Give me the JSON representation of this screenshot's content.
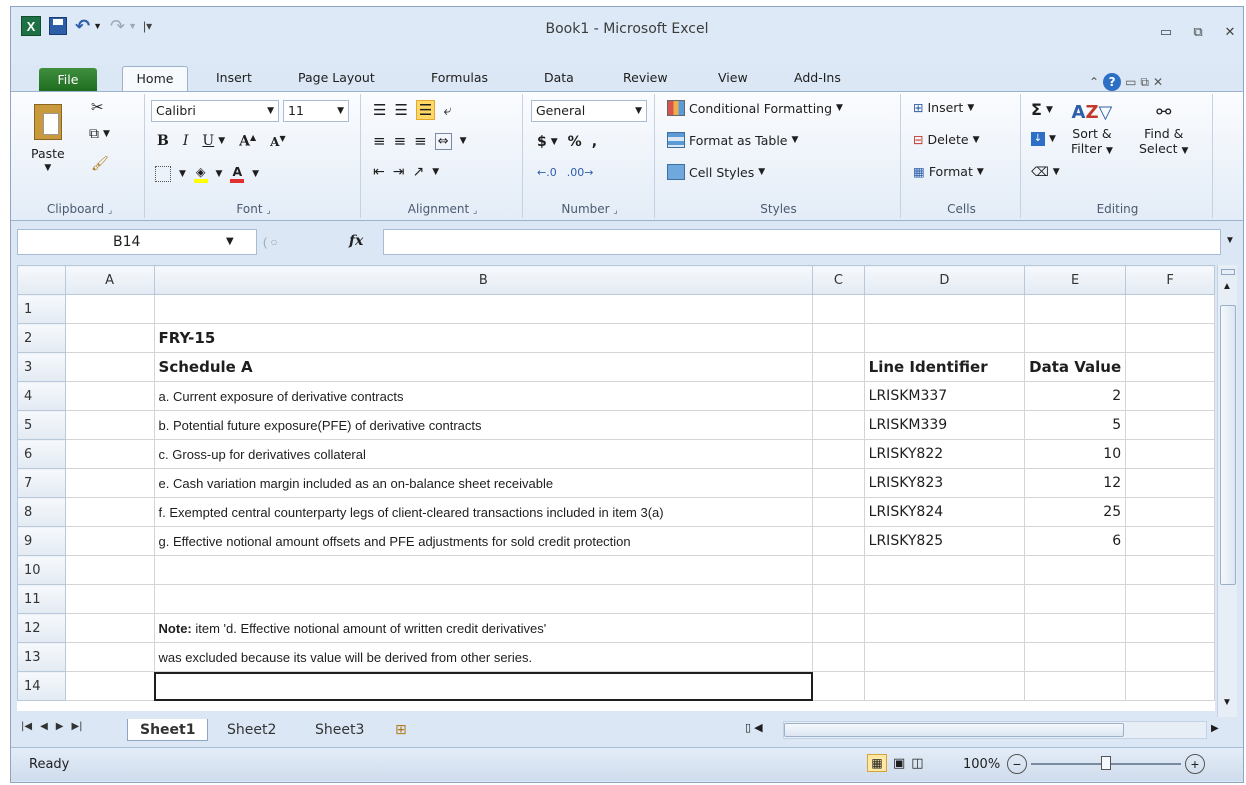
{
  "window": {
    "title": "Book1  -  Microsoft Excel",
    "minimize_glyph": "▭",
    "restore_glyph": "⧉",
    "close_glyph": "✕"
  },
  "ribbon_tabs": [
    "File",
    "Home",
    "Insert",
    "Page Layout",
    "Formulas",
    "Data",
    "Review",
    "View",
    "Add-Ins"
  ],
  "ribbon": {
    "clipboard": {
      "label": "Clipboard",
      "paste": "Paste"
    },
    "font": {
      "label": "Font",
      "name": "Calibri",
      "size": "11",
      "bold": "B",
      "italic": "I",
      "underline": "U"
    },
    "alignment": {
      "label": "Alignment"
    },
    "number": {
      "label": "Number",
      "format": "General",
      "currency": "$",
      "percent": "%",
      "comma": ","
    },
    "styles": {
      "label": "Styles",
      "conditional": "Conditional Formatting",
      "format_table": "Format as Table",
      "cell_styles": "Cell Styles"
    },
    "cells": {
      "label": "Cells",
      "insert": "Insert",
      "delete": "Delete",
      "format": "Format"
    },
    "editing": {
      "label": "Editing",
      "sort_filter_1": "Sort &",
      "sort_filter_2": "Filter",
      "find_select_1": "Find &",
      "find_select_2": "Select"
    }
  },
  "formula_bar": {
    "name_box": "B14",
    "fx": "fx",
    "value": ""
  },
  "columns": [
    "A",
    "B",
    "C",
    "D",
    "E",
    "F"
  ],
  "rows": [
    {
      "n": "1",
      "b": "",
      "d": "",
      "e": ""
    },
    {
      "n": "2",
      "b": "FRY-15",
      "d": "",
      "e": ""
    },
    {
      "n": "3",
      "b": "Schedule A",
      "d": "Line Identifier",
      "e": "Data Value"
    },
    {
      "n": "4",
      "b": "a. Current exposure of derivative contracts",
      "d": "LRISKM337",
      "e": "2"
    },
    {
      "n": "5",
      "b": "b. Potential future exposure(PFE) of derivative contracts",
      "d": "LRISKM339",
      "e": "5"
    },
    {
      "n": "6",
      "b": "c. Gross-up for derivatives collateral",
      "d": "LRISKY822",
      "e": "10"
    },
    {
      "n": "7",
      "b": "e. Cash variation margin included as an on-balance sheet receivable",
      "d": "LRISKY823",
      "e": "12"
    },
    {
      "n": "8",
      "b": "f. Exempted central counterparty legs of client-cleared transactions included in item 3(a)",
      "d": "LRISKY824",
      "e": "25"
    },
    {
      "n": "9",
      "b": "g. Effective notional amount offsets and PFE adjustments for sold credit protection",
      "d": "LRISKY825",
      "e": "6"
    },
    {
      "n": "10",
      "b": "",
      "d": "",
      "e": ""
    },
    {
      "n": "11",
      "b": "",
      "d": "",
      "e": ""
    },
    {
      "n": "12",
      "b_bold": "Note:",
      "b": " item 'd. Effective notional amount of written credit derivatives'",
      "d": "",
      "e": ""
    },
    {
      "n": "13",
      "b": "was excluded because its value will be derived from other series.",
      "d": "",
      "e": ""
    },
    {
      "n": "14",
      "b": "",
      "d": "",
      "e": ""
    }
  ],
  "sheets": [
    "Sheet1",
    "Sheet2",
    "Sheet3"
  ],
  "status": {
    "ready": "Ready",
    "zoom": "100%"
  },
  "colors": {
    "file_tab": "#2a7a2a",
    "frame": "#dbe7f4",
    "grid_line": "#d4d4d4"
  }
}
